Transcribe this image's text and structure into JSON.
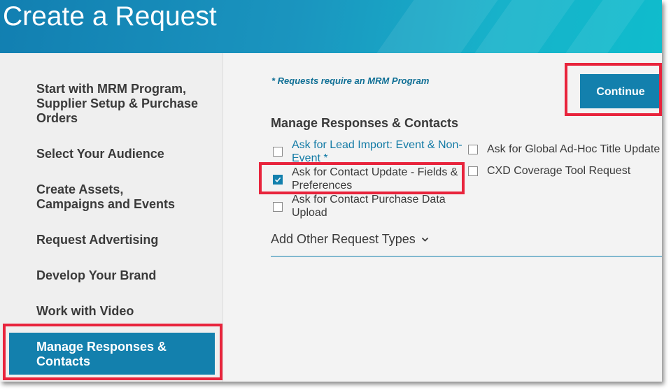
{
  "header": {
    "title": "Create a Request"
  },
  "sidebar": {
    "items": [
      {
        "label": "Start with MRM Program, Supplier Setup & Purchase Orders"
      },
      {
        "label": "Select Your Audience"
      },
      {
        "label": "Create Assets, Campaigns and Events"
      },
      {
        "label": "Request Advertising"
      },
      {
        "label": "Develop Your Brand"
      },
      {
        "label": "Work with Video"
      },
      {
        "label": "Manage Responses & Contacts",
        "active": true
      }
    ]
  },
  "main": {
    "note": "* Requests require an MRM Program",
    "continue_label": "Continue",
    "section_title": "Manage Responses & Contacts",
    "options": [
      {
        "label": "Ask for Lead Import: Event & Non-Event *",
        "checked": false,
        "link": true
      },
      {
        "label": "Ask for Contact Update - Fields & Preferences",
        "checked": true
      },
      {
        "label": "Ask for Contact Purchase Data Upload",
        "checked": false
      },
      {
        "label": "Ask for Global Ad-Hoc Title Update",
        "checked": false
      },
      {
        "label": "CXD Coverage Tool Request",
        "checked": false
      }
    ],
    "add_other_label": "Add Other Request Types"
  },
  "icons": {
    "checkbox_checked": "check-icon",
    "add_other": "chevron-down-icon"
  },
  "colors": {
    "accent": "#1380ad",
    "link": "#127aa5",
    "highlight": "#e8243c",
    "text": "#3a3a3a"
  }
}
